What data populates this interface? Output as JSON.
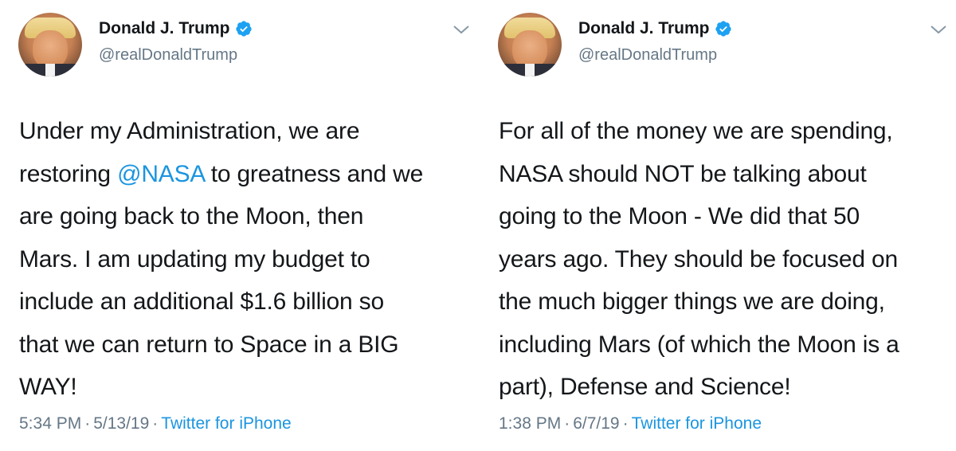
{
  "tweets": [
    {
      "name": "Donald J. Trump",
      "handle": "@realDonaldTrump",
      "text_before": "Under my Administration, we are\nrestoring ",
      "mention": "@NASA",
      "text_after": " to greatness and we\nare going back to the Moon, then\nMars. I am updating my budget to\ninclude an additional $1.6 billion so\nthat we can return to Space in a BIG\nWAY!",
      "time": "5:34 PM",
      "separator": "·",
      "date": "5/13/19",
      "source": "Twitter for iPhone",
      "verified_icon": "verified-badge-icon",
      "menu_icon": "chevron-down-icon",
      "accent_color": "#1b95e0"
    },
    {
      "name": "Donald J. Trump",
      "handle": "@realDonaldTrump",
      "text": "For all of the money we are spending,\nNASA should NOT be talking about\ngoing to the Moon - We did that 50\nyears ago. They should be focused on\nthe much bigger things we are doing,\nincluding Mars (of which the Moon is a\npart), Defense and Science!",
      "time": "1:38 PM",
      "separator": "·",
      "date": "6/7/19",
      "source": "Twitter for iPhone",
      "verified_icon": "verified-badge-icon",
      "menu_icon": "chevron-down-icon",
      "accent_color": "#1b95e0"
    }
  ]
}
